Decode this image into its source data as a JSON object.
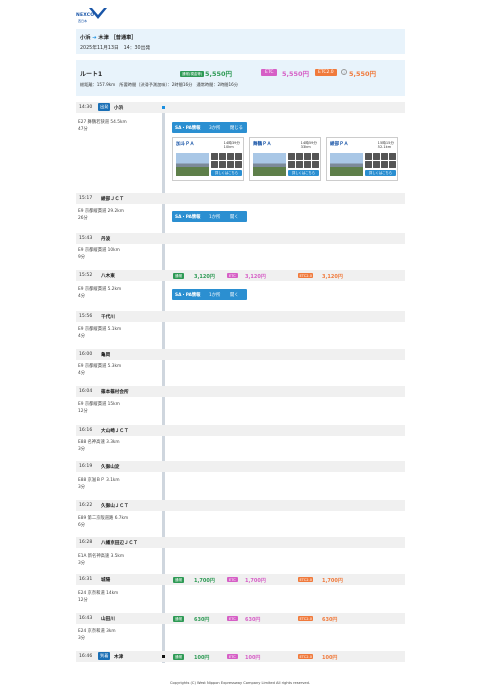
{
  "logo": {
    "text": "NEXCO",
    "sub": "西日本"
  },
  "route": {
    "from": "小浜",
    "to": "木津",
    "kind": "［普通車］",
    "datetime": "2025年11月13日　14：30出発"
  },
  "summary": {
    "name": "ルート1",
    "badges": {
      "normal": "通常(現金等)",
      "etc": "ETC",
      "etc2": "ETC2.0"
    },
    "prices": {
      "normal": "5,550円",
      "etc": "5,550円",
      "etc2": "5,550円"
    },
    "meta": "総距離：157.9km　所要時間（渋滞予測加味）：2時間16分　通常時間：2時間16分"
  },
  "tags": {
    "dep": "出発",
    "arr": "到着"
  },
  "ic": [
    {
      "time": "14:30",
      "name": "小浜"
    },
    {
      "time": "15:17",
      "name": "綾部ＪＣＴ"
    },
    {
      "time": "15:43",
      "name": "丹波"
    },
    {
      "time": "15:52",
      "name": "八木東"
    },
    {
      "time": "15:56",
      "name": "千代川"
    },
    {
      "time": "16:00",
      "name": "亀岡"
    },
    {
      "time": "16:04",
      "name": "篠本篠村会所"
    },
    {
      "time": "16:16",
      "name": "大山崎ＪＣＴ"
    },
    {
      "time": "16:19",
      "name": "久御山淀"
    },
    {
      "time": "16:22",
      "name": "久御山ＪＣＴ"
    },
    {
      "time": "16:28",
      "name": "八幡京田辺ＪＣＴ"
    },
    {
      "time": "16:31",
      "name": "城陽"
    },
    {
      "time": "16:43",
      "name": "山田川"
    },
    {
      "time": "16:46",
      "name": "木津"
    }
  ],
  "segments": [
    {
      "road": "E27 舞鶴若狭道 54.5km",
      "dur": "47分"
    },
    {
      "road": "E9 京都縦貫道 29.2km",
      "dur": "26分"
    },
    {
      "road": "E9 京都縦貫道 10km",
      "dur": "9分"
    },
    {
      "road": "E9 京都縦貫道 5.2km",
      "dur": "4分"
    },
    {
      "road": "E9 京都縦貫道 5.1km",
      "dur": "4分"
    },
    {
      "road": "E9 京都縦貫道 5.3km",
      "dur": "4分"
    },
    {
      "road": "E9 京都縦貫道 15km",
      "dur": "12分"
    },
    {
      "road": "E88 名神高速 3.3km",
      "dur": "3分"
    },
    {
      "road": "E88 京滋ＢＰ 3.1km",
      "dur": "3分"
    },
    {
      "road": "E89 第二京阪道路 6.7km",
      "dur": "6分"
    },
    {
      "road": "E1A 新名神高速 3.5km",
      "dur": "3分"
    },
    {
      "road": "E24 京奈和道 14km",
      "dur": "12分"
    },
    {
      "road": "E24 京奈和道 3km",
      "dur": "3分"
    }
  ],
  "sapa": [
    {
      "label": "SA・PA情報",
      "count": "3か所",
      "action": "閉じる"
    },
    {
      "label": "SA・PA情報",
      "count": "1か所",
      "action": "開く"
    },
    {
      "label": "SA・PA情報",
      "count": "1か所",
      "action": "開く"
    }
  ],
  "cards": [
    {
      "name": "加斗ＰＡ",
      "time": "14時39分",
      "dist": "10km",
      "more": "詳しくはこちら"
    },
    {
      "name": "舞鶴ＰＡ",
      "time": "14時59分",
      "dist": "33km",
      "more": "詳しくはこちら"
    },
    {
      "name": "綾部ＰＡ",
      "time": "15時15分",
      "dist": "52.1km",
      "more": "詳しくはこちら"
    }
  ],
  "tolls": [
    {
      "normal": "3,120円",
      "etc": "3,120円",
      "etc2": "3,120円"
    },
    {
      "normal": "1,700円",
      "etc": "1,700円",
      "etc2": "1,700円"
    },
    {
      "normal": "630円",
      "etc": "630円",
      "etc2": "630円"
    },
    {
      "normal": "100円",
      "etc": "100円",
      "etc2": "100円"
    }
  ],
  "toll_labels": {
    "normal": "通常",
    "etc": "ETC",
    "etc2": "ETC2.0"
  },
  "footer": "Copyrights (C) West Nippon Expressway Company Limited All rights reserved.",
  "colors": {
    "normal": "#2e9a55",
    "etc": "#d65fc6",
    "etc2": "#f07a3c",
    "accent": "#2b8fd1"
  }
}
